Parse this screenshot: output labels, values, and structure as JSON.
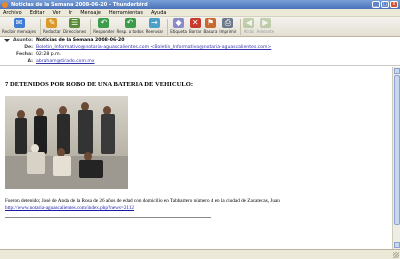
{
  "window": {
    "title": "Noticias de la Semana 2008-06-20 - Thunderbird",
    "min_label": "_",
    "max_label": "□",
    "close_label": "x"
  },
  "menu": [
    "Archivo",
    "Editar",
    "Ver",
    "Ir",
    "Mensaje",
    "Herramientas",
    "Ayuda"
  ],
  "toolbar": [
    {
      "label": "Recibir mensajes",
      "icon": "get-mail-icon",
      "color": "#3d7dd6",
      "glyph": "✉",
      "disabled": false
    },
    {
      "label": "Redactar",
      "icon": "compose-icon",
      "color": "#d99a2b",
      "glyph": "✎",
      "disabled": false
    },
    {
      "label": "Direcciones",
      "icon": "address-book-icon",
      "color": "#5b8c3a",
      "glyph": "☰",
      "disabled": false
    },
    {
      "label": "Responder",
      "icon": "reply-icon",
      "color": "#3b9c4a",
      "glyph": "↶",
      "disabled": false
    },
    {
      "label": "Resp. a todos",
      "icon": "reply-all-icon",
      "color": "#3b9c4a",
      "glyph": "↶",
      "disabled": false
    },
    {
      "label": "Reenviar",
      "icon": "forward-icon",
      "color": "#4aa0c9",
      "glyph": "→",
      "disabled": false
    },
    {
      "label": "Etiqueta",
      "icon": "tag-icon",
      "color": "#8a8ac8",
      "glyph": "◆",
      "disabled": false
    },
    {
      "label": "Borrar",
      "icon": "delete-icon",
      "color": "#c83a2e",
      "glyph": "✕",
      "disabled": false
    },
    {
      "label": "Basura",
      "icon": "junk-icon",
      "color": "#c86a2e",
      "glyph": "⚑",
      "disabled": false
    },
    {
      "label": "Imprimir",
      "icon": "print-icon",
      "color": "#6e7a8c",
      "glyph": "⎙",
      "disabled": false
    },
    {
      "label": "Atrás",
      "icon": "back-icon",
      "color": "#7aa058",
      "glyph": "◀",
      "disabled": true
    },
    {
      "label": "Adelante",
      "icon": "forward-nav-icon",
      "color": "#7aa058",
      "glyph": "▶",
      "disabled": true
    }
  ],
  "header": {
    "subject_label": "Asunto:",
    "subject": "Noticias de la Semana 2008-06-20",
    "from_label": "De:",
    "from": "Boletin_Informativo@notaria-aguascalientes.com <Boletin_Informativo@notaria-aguascalientes.com>",
    "date_label": "Fecha:",
    "date": "02:28 p.m.",
    "to_label": "A:",
    "to": "abraham@tirado.com.mx"
  },
  "message": {
    "headline": "7 DETENIDOS POR ROBO DE UNA BATERIA DE VEHICULO:",
    "body": "Fueron detenido; José de Anda de la Rosa de 26 años de edad con domicilio en Tabbartero número 4 en la ciudad de Zacatecas, Juan",
    "link": "http://www.notaria-aguascalientes.com/index.php?news=2112"
  },
  "colors": {
    "titlebar": "#4a72b8",
    "chrome": "#ece9d8",
    "link": "#1a1aaa"
  }
}
